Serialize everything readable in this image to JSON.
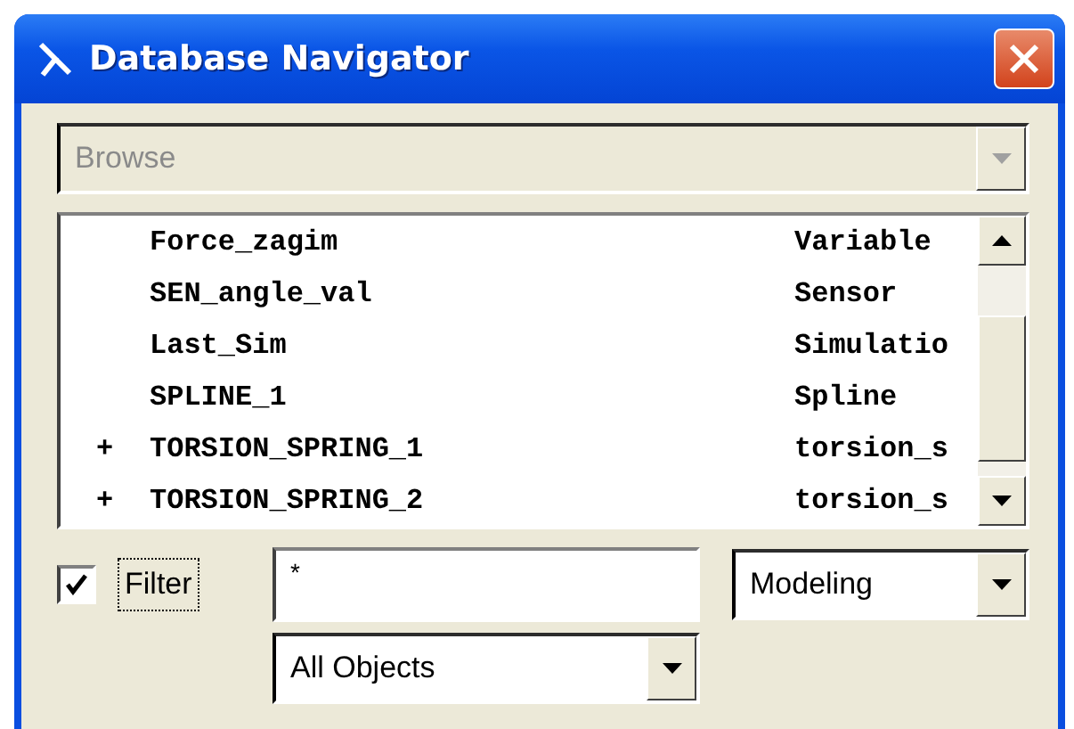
{
  "window": {
    "title": "Database Navigator"
  },
  "mode": {
    "value": "Browse",
    "disabled": true
  },
  "list": {
    "rows": [
      {
        "prefix": "",
        "name": "Force_zagim",
        "type": "Variable"
      },
      {
        "prefix": "",
        "name": "SEN_angle_val",
        "type": "Sensor"
      },
      {
        "prefix": "",
        "name": "Last_Sim",
        "type": "Simulatio"
      },
      {
        "prefix": "",
        "name": "SPLINE_1",
        "type": "Spline"
      },
      {
        "prefix": "+",
        "name": "TORSION_SPRING_1",
        "type": "torsion_s"
      },
      {
        "prefix": "+",
        "name": "TORSION_SPRING_2",
        "type": "torsion_s"
      }
    ]
  },
  "filter": {
    "label": "Filter",
    "checked": true,
    "pattern": "*",
    "category": "Modeling",
    "objects": "All Objects"
  }
}
